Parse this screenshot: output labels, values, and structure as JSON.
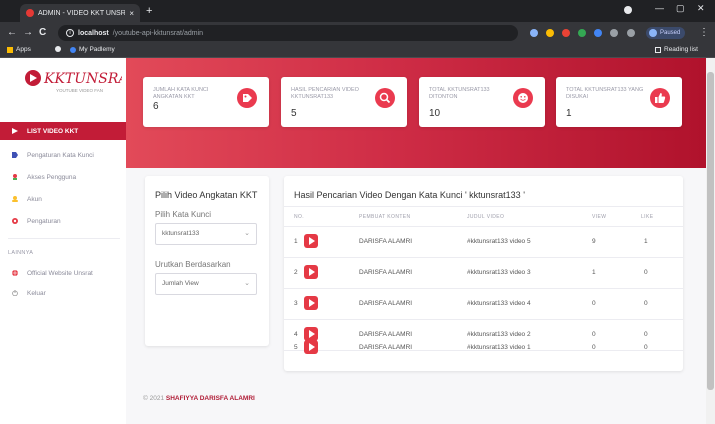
{
  "browser": {
    "tab_title": "ADMIN - VIDEO KKT UNSRAT - Y",
    "tab_close": "×",
    "new_tab": "+",
    "minimize": "—",
    "maximize": "▢",
    "close": "✕",
    "back": "←",
    "forward": "→",
    "reload": "C",
    "url_host": "localhost",
    "url_path": "/youtube-api-kktunsrat/admin",
    "profile_status": "Paused",
    "bookmarks": [
      "Apps",
      "My Padlemy"
    ],
    "reading_list": "Reading list"
  },
  "sidebar": {
    "logo_text": "KKTUNSRAT",
    "logo_subtext": "YOUTUBE VIDEO FAN",
    "items": [
      {
        "label": "LIST VIDEO KKT",
        "icon": "play-triangle-icon",
        "active": true
      },
      {
        "label": "Pengaturan Kata Kunci",
        "icon": "tag-icon",
        "active": false
      },
      {
        "label": "Akses Pengguna",
        "icon": "user-key-icon",
        "active": false
      },
      {
        "label": "Akun",
        "icon": "person-icon",
        "active": false
      },
      {
        "label": "Pengaturan",
        "icon": "gear-icon",
        "active": false
      }
    ],
    "section_label": "LAINNYA",
    "extra_items": [
      {
        "label": "Official Website Unsrat",
        "icon": "globe-icon"
      },
      {
        "label": "Keluar",
        "icon": "power-icon"
      }
    ]
  },
  "stats": [
    {
      "label": "JUMLAH KATA KUNCI ANGKATAN KKT",
      "value": "6",
      "icon": "tag-icon"
    },
    {
      "label": "HASIL PENCARIAN VIDEO KKTUNSRAT133",
      "value": "5",
      "icon": "search-icon"
    },
    {
      "label": "TOTAL KKTUNSRAT133 DITONTON",
      "value": "10",
      "icon": "smile-icon"
    },
    {
      "label": "TOTAL KKTUNSRAT133 YANG DISUKAI",
      "value": "1",
      "icon": "thumbs-up-icon"
    }
  ],
  "filter": {
    "title": "Pilih Video Angkatan KKT",
    "keyword_label": "Pilih Kata Kunci",
    "keyword_value": "kktunsrat133",
    "sort_label": "Urutkan Berdasarkan",
    "sort_value": "Jumlah View",
    "caret": "⌄"
  },
  "results": {
    "title": "Hasil Pencarian Video Dengan Kata Kunci ' kktunsrat133 '",
    "columns": [
      "NO.",
      "PEMBUAT KONTEN",
      "JUDUL VIDEO",
      "VIEW",
      "LIKE"
    ],
    "rows": [
      {
        "no": "1",
        "creator": "DARISFA ALAMRI",
        "title": "#kktunsrat133 video 5",
        "view": "9",
        "like": "1"
      },
      {
        "no": "2",
        "creator": "DARISFA ALAMRI",
        "title": "#kktunsrat133 video 3",
        "view": "1",
        "like": "0"
      },
      {
        "no": "3",
        "creator": "DARISFA ALAMRI",
        "title": "#kktunsrat133 video 4",
        "view": "0",
        "like": "0"
      },
      {
        "no": "4",
        "creator": "DARISFA ALAMRI",
        "title": "#kktunsrat133 video 2",
        "view": "0",
        "like": "0"
      },
      {
        "no": "5",
        "creator": "DARISFA ALAMRI",
        "title": "#kktunsrat133 video 1",
        "view": "0",
        "like": "0"
      }
    ]
  },
  "footer": {
    "prefix": "© 2021",
    "author": "SHAFIYYA DARISFA ALAMRI"
  },
  "colors": {
    "brand": "#c21c37",
    "accent": "#ea3a4f"
  }
}
